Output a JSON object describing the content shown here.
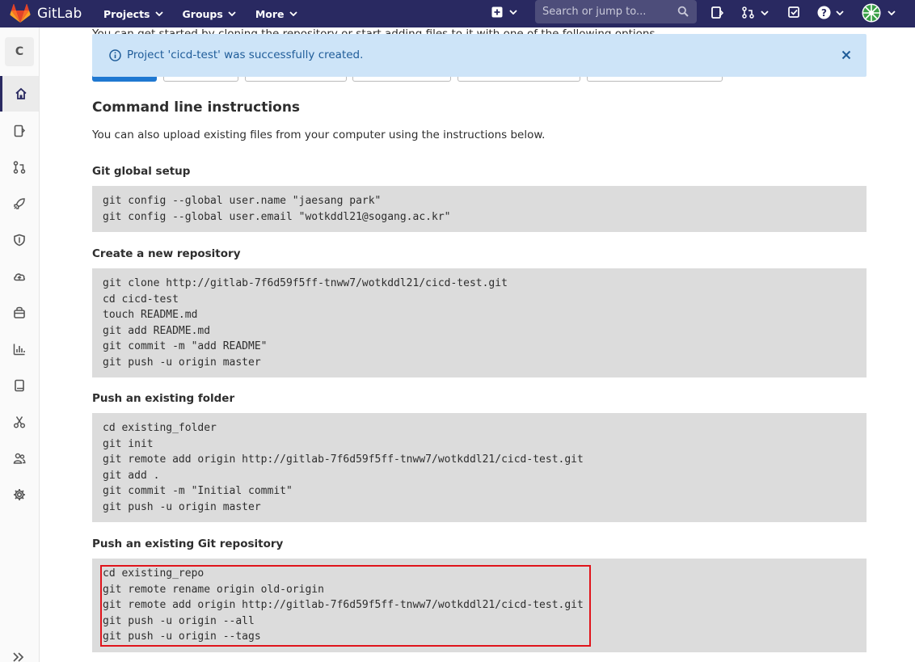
{
  "navbar": {
    "brand": "GitLab",
    "menu": [
      {
        "label": "Projects"
      },
      {
        "label": "Groups"
      },
      {
        "label": "More"
      }
    ],
    "search_placeholder": "Search or jump to..."
  },
  "sidebar": {
    "project_initial": "C",
    "items": [
      {
        "name": "project-overview",
        "icon": "home-icon"
      },
      {
        "name": "repository",
        "icon": "doc-icon"
      },
      {
        "name": "merge-requests",
        "icon": "merge-request-icon"
      },
      {
        "name": "ci-cd",
        "icon": "rocket-icon"
      },
      {
        "name": "security",
        "icon": "shield-icon"
      },
      {
        "name": "operations",
        "icon": "cloud-icon"
      },
      {
        "name": "packages",
        "icon": "package-icon"
      },
      {
        "name": "analytics",
        "icon": "chart-icon"
      },
      {
        "name": "wiki",
        "icon": "book-icon"
      },
      {
        "name": "snippets",
        "icon": "scissors-icon"
      },
      {
        "name": "members",
        "icon": "users-icon"
      },
      {
        "name": "settings",
        "icon": "gear-icon"
      }
    ]
  },
  "content": {
    "intro_text": "You can get started by cloning the repository or start adding files to it with one of the following options.",
    "flash_message": "Project 'cicd-test' was successfully created.",
    "heading": "Command line instructions",
    "subtitle": "You can also upload existing files from your computer using the instructions below.",
    "sections": [
      {
        "title": "Git global setup",
        "lines": [
          "git config --global user.name \"jaesang park\"",
          "git config --global user.email \"wotkddl21@sogang.ac.kr\""
        ]
      },
      {
        "title": "Create a new repository",
        "lines": [
          "git clone http://gitlab-7f6d59f5ff-tnww7/wotkddl21/cicd-test.git",
          "cd cicd-test",
          "touch README.md",
          "git add README.md",
          "git commit -m \"add README\"",
          "git push -u origin master"
        ]
      },
      {
        "title": "Push an existing folder",
        "lines": [
          "cd existing_folder",
          "git init",
          "git remote add origin http://gitlab-7f6d59f5ff-tnww7/wotkddl21/cicd-test.git",
          "git add .",
          "git commit -m \"Initial commit\"",
          "git push -u origin master"
        ]
      },
      {
        "title": "Push an existing Git repository",
        "lines": [
          "cd existing_repo",
          "git remote rename origin old-origin",
          "git remote add origin http://gitlab-7f6d59f5ff-tnww7/wotkddl21/cicd-test.git",
          "git push -u origin --all",
          "git push -u origin --tags"
        ]
      }
    ]
  },
  "colors": {
    "navbar": "#292961",
    "flash_bg": "#cde4f8",
    "flash_text": "#1f5c99",
    "code_bg": "#dcdcdc",
    "highlight": "#e0141b"
  }
}
